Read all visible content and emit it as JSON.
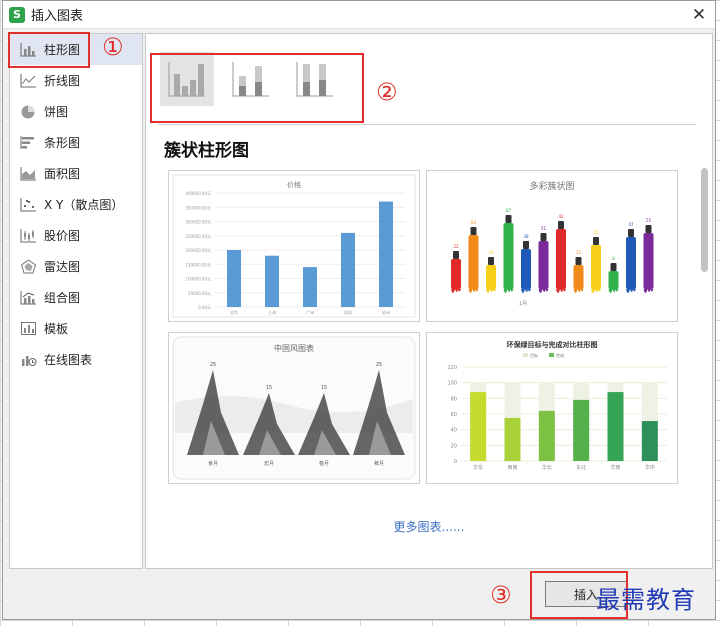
{
  "window": {
    "title": "插入图表",
    "app_icon_letter": "S",
    "close_glyph": "✕"
  },
  "sidebar": {
    "items": [
      {
        "label": "柱形图",
        "icon": "bar-chart-icon",
        "active": true
      },
      {
        "label": "折线图",
        "icon": "line-chart-icon"
      },
      {
        "label": "饼图",
        "icon": "pie-chart-icon"
      },
      {
        "label": "条形图",
        "icon": "horizontal-bar-icon"
      },
      {
        "label": "面积图",
        "icon": "area-chart-icon"
      },
      {
        "label": "X Y（散点图）",
        "icon": "scatter-chart-icon"
      },
      {
        "label": "股价图",
        "icon": "stock-chart-icon"
      },
      {
        "label": "雷达图",
        "icon": "radar-chart-icon"
      },
      {
        "label": "组合图",
        "icon": "combo-chart-icon"
      },
      {
        "label": "模板",
        "icon": "template-icon"
      },
      {
        "label": "在线图表",
        "icon": "online-chart-icon"
      }
    ]
  },
  "main": {
    "subtypes": [
      {
        "name": "clustered-column-icon",
        "active": true
      },
      {
        "name": "stacked-column-icon"
      },
      {
        "name": "percent-stacked-column-icon"
      }
    ],
    "section_title": "簇状柱形图",
    "templates": [
      {
        "title": "价格",
        "chart_data": {
          "type": "bar",
          "title": "价格",
          "categories": [
            "北京",
            "上海",
            "广州",
            "深圳",
            "杭州"
          ],
          "values": [
            200000,
            180000,
            140000,
            260000,
            370000
          ],
          "y_ticks": [
            "0.00元",
            "50000.00元",
            "100000.00元",
            "150000.00元",
            "200000.00元",
            "250000.00元",
            "300000.00元",
            "350000.00元",
            "400000.00元"
          ],
          "ylim": [
            0,
            400000
          ],
          "color": "#5b9bd5"
        }
      },
      {
        "title": "多彩簇状图",
        "labels": [
          "22",
          "63",
          "16",
          "87",
          "38",
          "51",
          "42",
          "12",
          "25",
          "8",
          "47",
          "55"
        ],
        "x_label": "1月"
      },
      {
        "title": "中国风图表",
        "labels": [
          "25",
          "15",
          "15",
          "25"
        ],
        "categories": [
          "食月",
          "宏月",
          "春月",
          "稗月"
        ]
      },
      {
        "title": "环保绿目标与完成对比柱形图",
        "legend": [
          "目标",
          "完成"
        ],
        "chart_data": {
          "type": "bar",
          "categories": [
            "华东",
            "西南",
            "华北",
            "东北",
            "华南",
            "华中"
          ],
          "series": [
            {
              "name": "目标",
              "values": [
                100,
                100,
                100,
                100,
                100,
                100
              ]
            },
            {
              "name": "完成",
              "values": [
                88,
                55,
                64,
                78,
                88,
                51
              ]
            }
          ],
          "y_ticks": [
            "0",
            "20",
            "40",
            "60",
            "80",
            "100",
            "120"
          ],
          "ylim": [
            0,
            120
          ]
        }
      }
    ],
    "more_link": "更多图表......"
  },
  "footer": {
    "insert_label": "插入"
  },
  "annotations": {
    "marker_1": "①",
    "marker_2": "②",
    "marker_3": "③",
    "watermark": "最需教育"
  },
  "colors": {
    "highlight": "#e0302c",
    "link": "#3b6fc4",
    "watermark": "#1f3ab4",
    "active_bg": "#dfe6f1"
  }
}
